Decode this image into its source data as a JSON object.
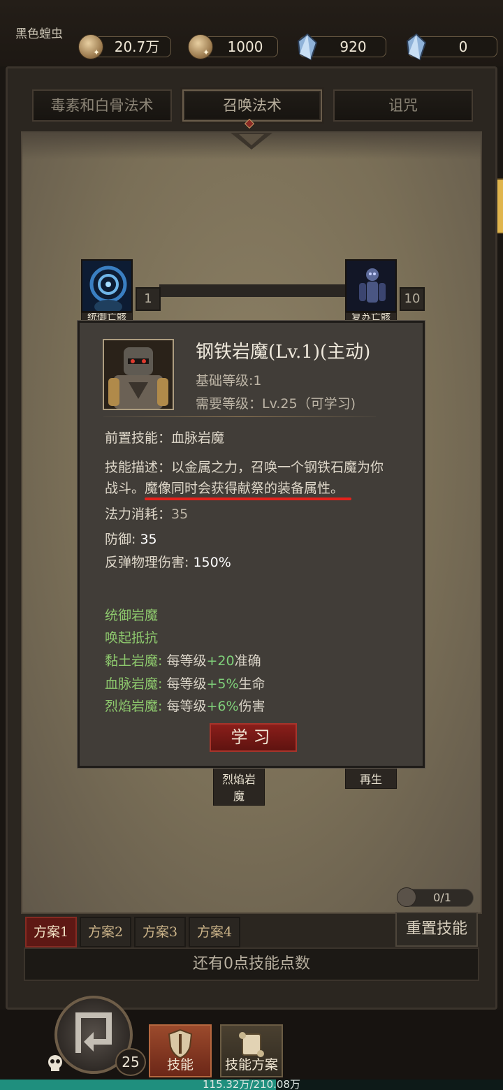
{
  "header": {
    "player_name": "黑色蝗虫",
    "currencies": [
      {
        "icon": "gold-coin-icon",
        "value": "20.7万"
      },
      {
        "icon": "bronze-coin-icon",
        "value": "1000"
      },
      {
        "icon": "blue-crystal-icon",
        "value": "920"
      },
      {
        "icon": "blue-crystal-icon",
        "value": "0"
      }
    ]
  },
  "tabs": [
    {
      "label": "毒素和白骨法术",
      "active": false
    },
    {
      "label": "召唤法术",
      "active": true
    },
    {
      "label": "诅咒",
      "active": false
    }
  ],
  "tree": {
    "nodes": [
      {
        "name": "统御亡骸",
        "level": "1"
      },
      {
        "name": "复苏亡骸",
        "level": "10"
      }
    ],
    "lower_labels": [
      "烈焰岩魔",
      "再生"
    ]
  },
  "popup": {
    "title": "钢铁岩魔(Lv.1)(主动)",
    "base_level": "基础等级:1",
    "required_level": "需要等级：Lv.25（可学习)",
    "prereq_label": "前置技能：",
    "prereq_value": "血脉岩魔",
    "desc_line1": "技能描述：以金属之力，召唤一个钢铁石魔为你",
    "desc_line2_a": "战斗。",
    "desc_line2_b": "魔像同时会获得献祭的装备属性。",
    "mana_label": "法力消耗：",
    "mana_value": "35",
    "defense_label": "防御: ",
    "defense_value": "35",
    "reflect_label": "反弹物理伤害: ",
    "reflect_value": "150%",
    "synergies": [
      {
        "name": "统御岩魔"
      },
      {
        "name": "唤起抵抗"
      },
      {
        "name": "黏土岩魔:",
        "pre": "每等级",
        "plus": "+20",
        "post": "准确"
      },
      {
        "name": "血脉岩魔:",
        "pre": "每等级",
        "plus": "+5%",
        "post": "生命"
      },
      {
        "name": "烈焰岩魔:",
        "pre": "每等级",
        "plus": "+6%",
        "post": "伤害"
      }
    ],
    "learn_button": "学习"
  },
  "plans": [
    "方案1",
    "方案2",
    "方案3",
    "方案4"
  ],
  "reset_button": "重置技能",
  "reset_points": "0/1",
  "skill_points_text": "还有0点技能点数",
  "bottom_nav": {
    "level": "25",
    "skills_label": "技能",
    "plans_label": "技能方案",
    "xp_text": "115.32万/210.08万",
    "xp_fraction": 0.549
  },
  "colors": {
    "accent_red": "#8a1e1a",
    "underline_red": "#e3221c",
    "synergy_green": "#8dc86d",
    "xp_teal": "#1f8f7e"
  }
}
